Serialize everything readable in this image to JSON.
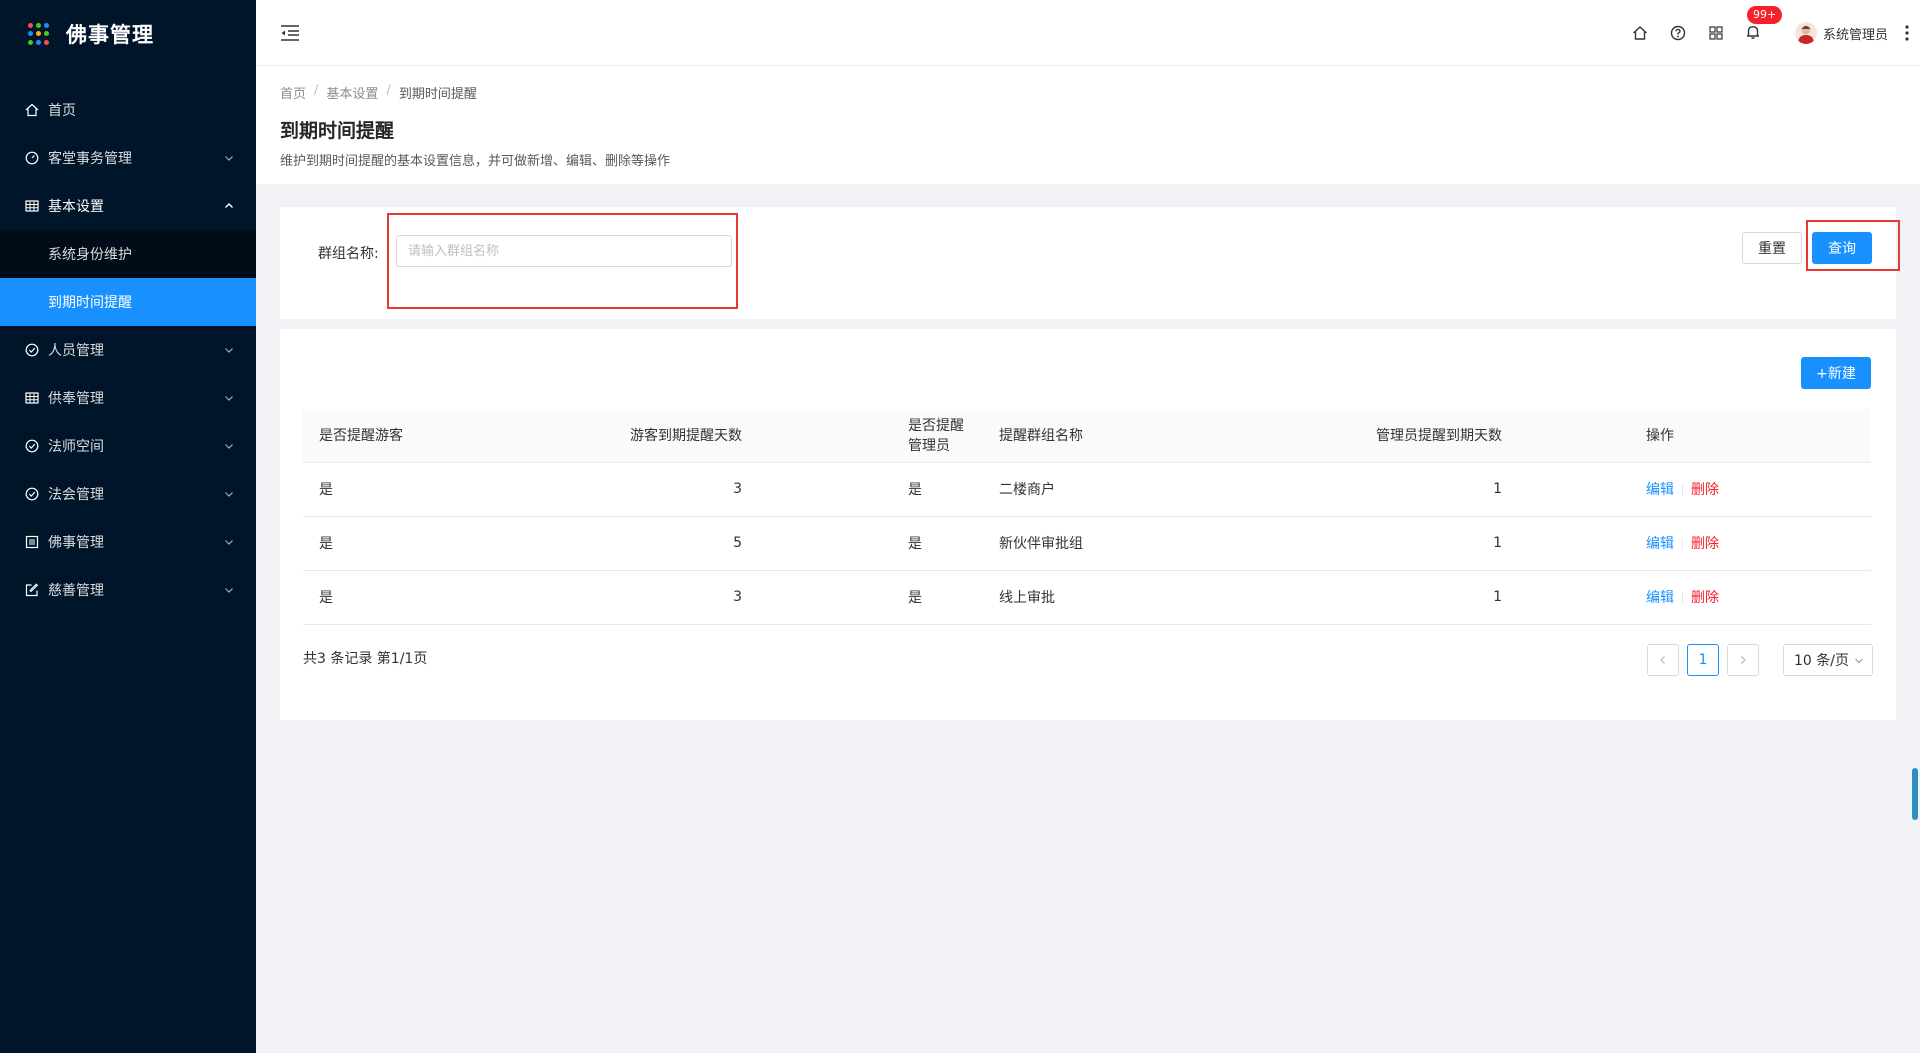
{
  "app": {
    "title": "佛事管理"
  },
  "sidebar": {
    "items": [
      {
        "label": "首页",
        "icon": "home-icon"
      },
      {
        "label": "客堂事务管理",
        "icon": "dashboard-icon"
      },
      {
        "label": "基本设置",
        "icon": "table-icon",
        "children": [
          {
            "label": "系统身份维护"
          },
          {
            "label": "到期时间提醒"
          }
        ]
      },
      {
        "label": "人员管理",
        "icon": "check-circle-icon"
      },
      {
        "label": "供奉管理",
        "icon": "table-icon"
      },
      {
        "label": "法师空间",
        "icon": "check-circle-icon"
      },
      {
        "label": "法会管理",
        "icon": "check-circle-icon"
      },
      {
        "label": "佛事管理",
        "icon": "list-icon"
      },
      {
        "label": "慈善管理",
        "icon": "edit-icon"
      }
    ]
  },
  "header": {
    "badge": "99+",
    "user_name": "系统管理员"
  },
  "page": {
    "breadcrumb": [
      "首页",
      "基本设置",
      "到期时间提醒"
    ],
    "title": "到期时间提醒",
    "description": "维护到期时间提醒的基本设置信息，并可做新增、编辑、删除等操作"
  },
  "search": {
    "label": "群组名称:",
    "placeholder": "请输入群组名称",
    "value": "",
    "reset_label": "重置",
    "query_label": "查询"
  },
  "table": {
    "new_label": "+新建",
    "columns": [
      "是否提醒游客",
      "游客到期提醒天数",
      "是否提醒管理员",
      "提醒群组名称",
      "管理员提醒到期天数",
      "操作"
    ],
    "rows": [
      {
        "remind_visitor": "是",
        "visitor_days": "3",
        "remind_admin": "是",
        "group_name": "二楼商户",
        "admin_days": "1",
        "edit": "编辑",
        "delete": "删除"
      },
      {
        "remind_visitor": "是",
        "visitor_days": "5",
        "remind_admin": "是",
        "group_name": "新伙伴审批组",
        "admin_days": "1",
        "edit": "编辑",
        "delete": "删除"
      },
      {
        "remind_visitor": "是",
        "visitor_days": "3",
        "remind_admin": "是",
        "group_name": "线上审批",
        "admin_days": "1",
        "edit": "编辑",
        "delete": "删除"
      }
    ]
  },
  "pagination": {
    "summary": "共3 条记录 第1/1页",
    "current_page": "1",
    "page_size": "10 条/页"
  },
  "colors": {
    "sidebar_bg": "#001529",
    "primary": "#1890ff",
    "danger": "#f5222d",
    "highlight_box": "#e53935"
  }
}
